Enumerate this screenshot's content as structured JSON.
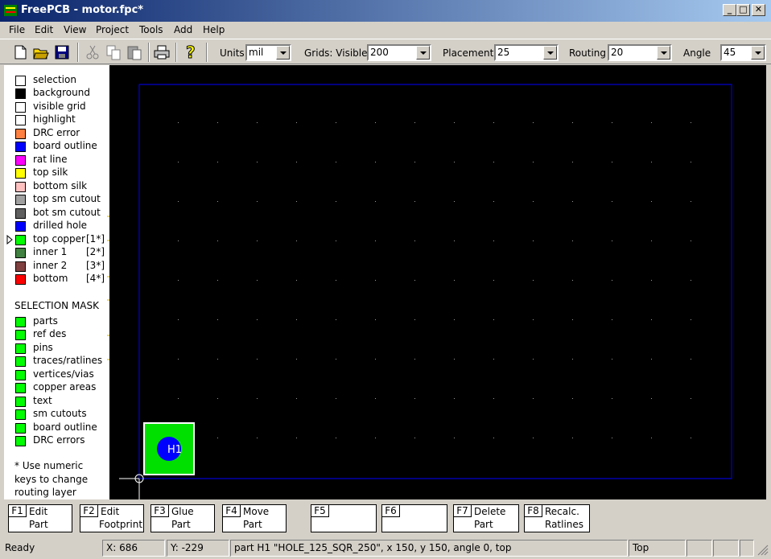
{
  "window": {
    "title": "FreePCB - motor.fpc*"
  },
  "menu": [
    "File",
    "Edit",
    "View",
    "Project",
    "Tools",
    "Add",
    "Help"
  ],
  "toolbar": {
    "units_label": "Units",
    "units_value": "mil",
    "grids_label": "Grids: Visible",
    "grids_value": "200",
    "placement_label": "Placement",
    "placement_value": "25",
    "routing_label": "Routing",
    "routing_value": "20",
    "angle_label": "Angle",
    "angle_value": "45"
  },
  "layers": [
    {
      "label": "selection",
      "num": "",
      "color": "#ffffff"
    },
    {
      "label": "background",
      "num": "",
      "color": "#000000"
    },
    {
      "label": "visible grid",
      "num": "",
      "color": "#ffffff"
    },
    {
      "label": "highlight",
      "num": "",
      "color": "#ffffff"
    },
    {
      "label": "DRC error",
      "num": "",
      "color": "#ff8040"
    },
    {
      "label": "board outline",
      "num": "",
      "color": "#0000ff"
    },
    {
      "label": "rat line",
      "num": "",
      "color": "#ff00ff"
    },
    {
      "label": "top silk",
      "num": "",
      "color": "#ffff00"
    },
    {
      "label": "bottom silk",
      "num": "",
      "color": "#ffc0c0"
    },
    {
      "label": "top sm cutout",
      "num": "",
      "color": "#a0a0a0"
    },
    {
      "label": "bot sm cutout",
      "num": "",
      "color": "#5f5f5f"
    },
    {
      "label": "drilled hole",
      "num": "",
      "color": "#0000ff"
    },
    {
      "label": "top copper",
      "num": "[1*]",
      "color": "#00ff00"
    },
    {
      "label": "inner 1",
      "num": "[2*]",
      "color": "#408040"
    },
    {
      "label": "inner 2",
      "num": "[3*]",
      "color": "#804040"
    },
    {
      "label": "bottom",
      "num": "[4*]",
      "color": "#ff0000"
    }
  ],
  "selection_mask": {
    "title": "SELECTION MASK",
    "items": [
      "parts",
      "ref des",
      "pins",
      "traces/ratlines",
      "vertices/vias",
      "copper areas",
      "text",
      "sm cutouts",
      "board outline",
      "DRC errors"
    ],
    "color": "#00ff00"
  },
  "note": [
    "* Use numeric",
    "keys to change",
    "routing layer"
  ],
  "part": {
    "ref": "H1"
  },
  "fkeys": [
    {
      "key": "F1",
      "l1": "Edit",
      "l2": "Part"
    },
    {
      "key": "F2",
      "l1": "Edit",
      "l2": "Footprint"
    },
    {
      "key": "F3",
      "l1": "Glue",
      "l2": "Part"
    },
    {
      "key": "F4",
      "l1": "Move",
      "l2": "Part"
    },
    {
      "key": "F5",
      "l1": "",
      "l2": ""
    },
    {
      "key": "F6",
      "l1": "",
      "l2": ""
    },
    {
      "key": "F7",
      "l1": "Delete",
      "l2": "Part"
    },
    {
      "key": "F8",
      "l1": "Recalc.",
      "l2": "Ratlines"
    }
  ],
  "status": {
    "ready": "Ready",
    "x": "X: 686",
    "y": "Y: -229",
    "info": "part H1 \"HOLE_125_SQR_250\", x 150, y 150, angle 0, top",
    "layer": "Top"
  }
}
